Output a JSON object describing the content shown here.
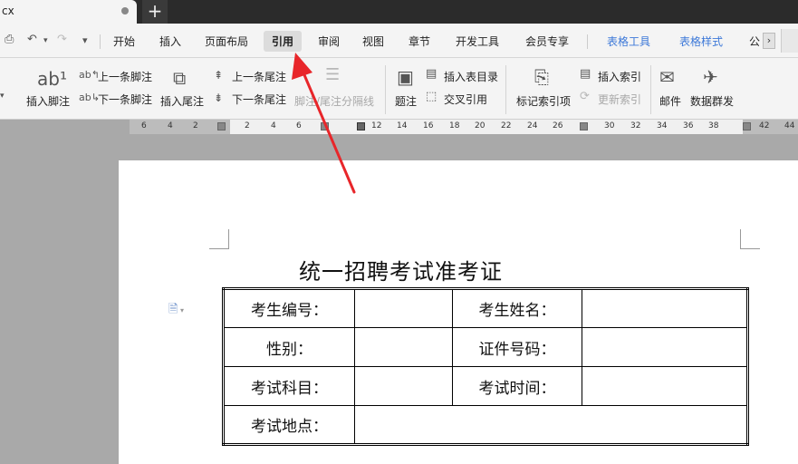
{
  "tab": {
    "label": "cx",
    "new_tab": "+"
  },
  "quick_access": {
    "undo": "↶",
    "redo": "↷",
    "more": "▾"
  },
  "menu": {
    "items": [
      "开始",
      "插入",
      "页面布局",
      "引用",
      "审阅",
      "视图",
      "章节",
      "开发工具",
      "会员专享"
    ],
    "active": "引用",
    "context_items": [
      "表格工具",
      "表格样式"
    ],
    "overflow": "公",
    "scroll": "›"
  },
  "ribbon": {
    "insert_footnote": "插入脚注",
    "prev_footnote": "上一条脚注",
    "next_footnote": "下一条脚注",
    "insert_endnote": "插入尾注",
    "prev_endnote": "上一条尾注",
    "next_endnote": "下一条尾注",
    "footnote_separator": "脚注/尾注分隔线",
    "caption": "题注",
    "insert_figure_toc": "插入表目录",
    "cross_reference": "交叉引用",
    "mark_index": "标记索引项",
    "insert_index": "插入索引",
    "update_index": "更新索引",
    "mail": "邮件",
    "data_send": "数据群发"
  },
  "ruler": {
    "left_ticks": [
      "6",
      "4",
      "2",
      "2",
      "4",
      "6"
    ],
    "right_ticks": [
      "12",
      "14",
      "16",
      "18",
      "20",
      "22",
      "24",
      "26",
      "30",
      "32",
      "34",
      "36",
      "38",
      "42",
      "44"
    ]
  },
  "document": {
    "title": "统一招聘考试准考证",
    "rows": [
      [
        "考生编号：",
        "",
        "考生姓名：",
        ""
      ],
      [
        "性别：",
        "",
        "证件号码：",
        ""
      ],
      [
        "考试科目：",
        "",
        "考试时间：",
        ""
      ],
      [
        "考试地点：",
        ""
      ]
    ]
  }
}
